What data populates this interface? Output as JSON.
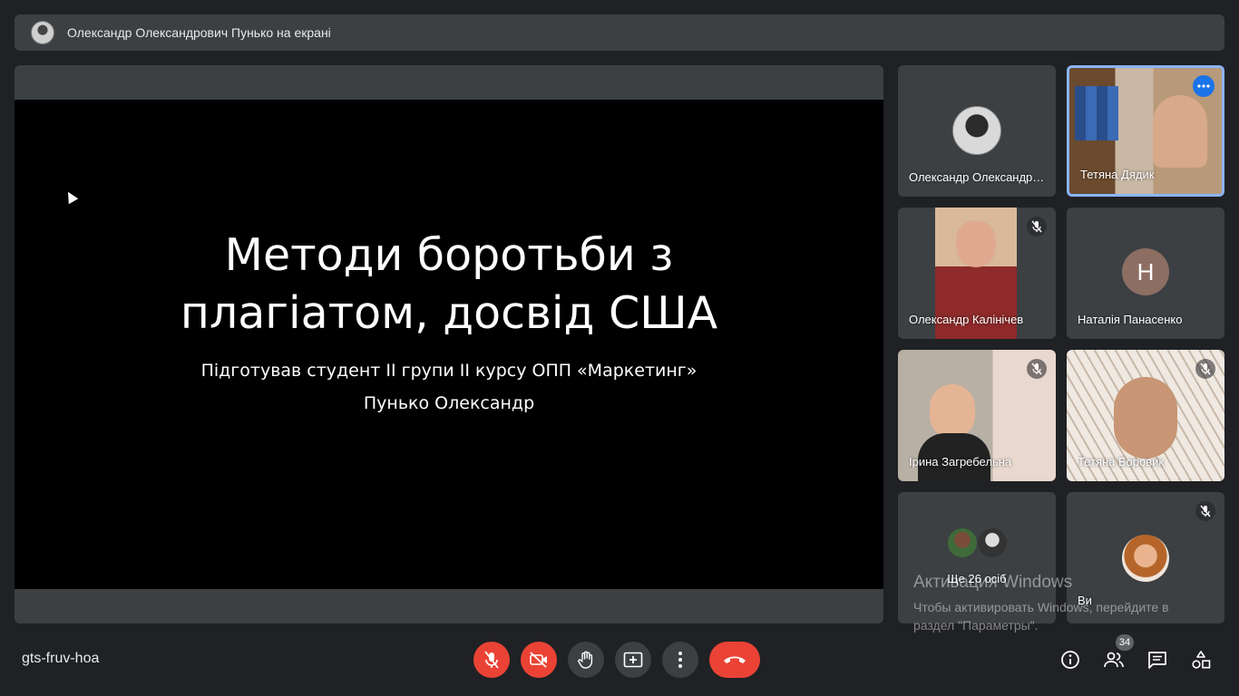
{
  "banner": {
    "presenter_text": "Олександр Олександрович Пунько на екрані"
  },
  "slide": {
    "title_line1": "Методи боротьби з",
    "title_line2": "плагіатом, досвід США",
    "subtitle_line1": "Підготував студент ІІ групи ІІ курсу ОПП «Маркетинг»",
    "subtitle_line2": "Пунько Олександр"
  },
  "participants": [
    {
      "name": "Олександр Олександрович Пунько",
      "muted": false
    },
    {
      "name": "Тетяна Дядик",
      "muted": false,
      "active_speaker": true
    },
    {
      "name": "Олександр Калінічев",
      "muted": true
    },
    {
      "name": "Наталія Панасенко",
      "avatar_letter": "Н",
      "avatar_color": "#8d6e63",
      "muted": false
    },
    {
      "name": "Ірина Загребельна",
      "muted": true
    },
    {
      "name": "Тетяна Боровик",
      "muted": true
    },
    {
      "name": "Ще 26 осіб"
    },
    {
      "name": "Ви",
      "muted": true
    }
  ],
  "toolbar": {
    "meeting_code": "gts-fruv-hoa",
    "people_count": "34",
    "accent_red": "#ea4335"
  },
  "watermark": {
    "line1": "Активация Windows",
    "line2": "Чтобы активировать Windows, перейдите в",
    "line3": "раздел \"Параметры\"."
  }
}
